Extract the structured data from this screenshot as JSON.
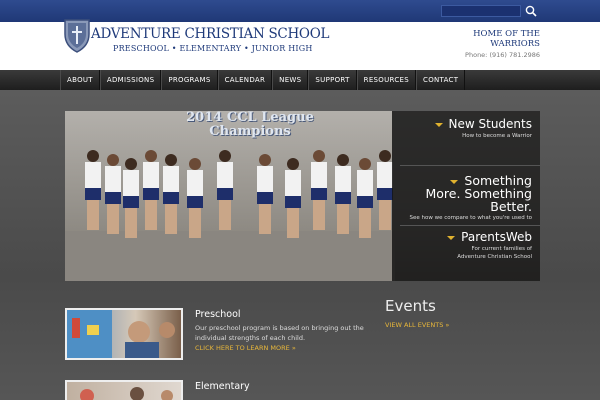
{
  "search": {
    "placeholder": ""
  },
  "header": {
    "school_name": "ADVENTURE CHRISTIAN SCHOOL",
    "school_sub": "PRESCHOOL • ELEMENTARY • JUNIOR HIGH",
    "home_of_line1": "HOME OF THE",
    "home_of_line2": "WARRIORS",
    "phone": "Phone: (916) 781.2986"
  },
  "nav": {
    "items": [
      "ABOUT",
      "ADMISSIONS",
      "PROGRAMS",
      "CALENDAR",
      "NEWS",
      "SUPPORT",
      "RESOURCES",
      "CONTACT"
    ]
  },
  "hero": {
    "banner_line1": "2014 CCL League",
    "banner_line2": "Champions",
    "panel": [
      {
        "title": "New Students",
        "sub": "How to become a Warrior"
      },
      {
        "title_line1": "Something",
        "title_line2": "More. Something",
        "title_line3": "Better.",
        "sub": "See how we compare to what you're used to"
      },
      {
        "title": "ParentsWeb",
        "sub_line1": "For current families of",
        "sub_line2": "Adventure Christian School"
      }
    ]
  },
  "preschool": {
    "title": "Preschool",
    "text_line1": "Our preschool program is based on bringing out the",
    "text_line2": "individual strengths of each child.",
    "link": "CLICK HERE TO LEARN MORE »"
  },
  "elementary": {
    "title": "Elementary"
  },
  "events": {
    "title": "Events",
    "link": "VIEW ALL EVENTS »"
  },
  "colors": {
    "brand_blue": "#1f3a7a",
    "accent_gold": "#e8b73a"
  }
}
